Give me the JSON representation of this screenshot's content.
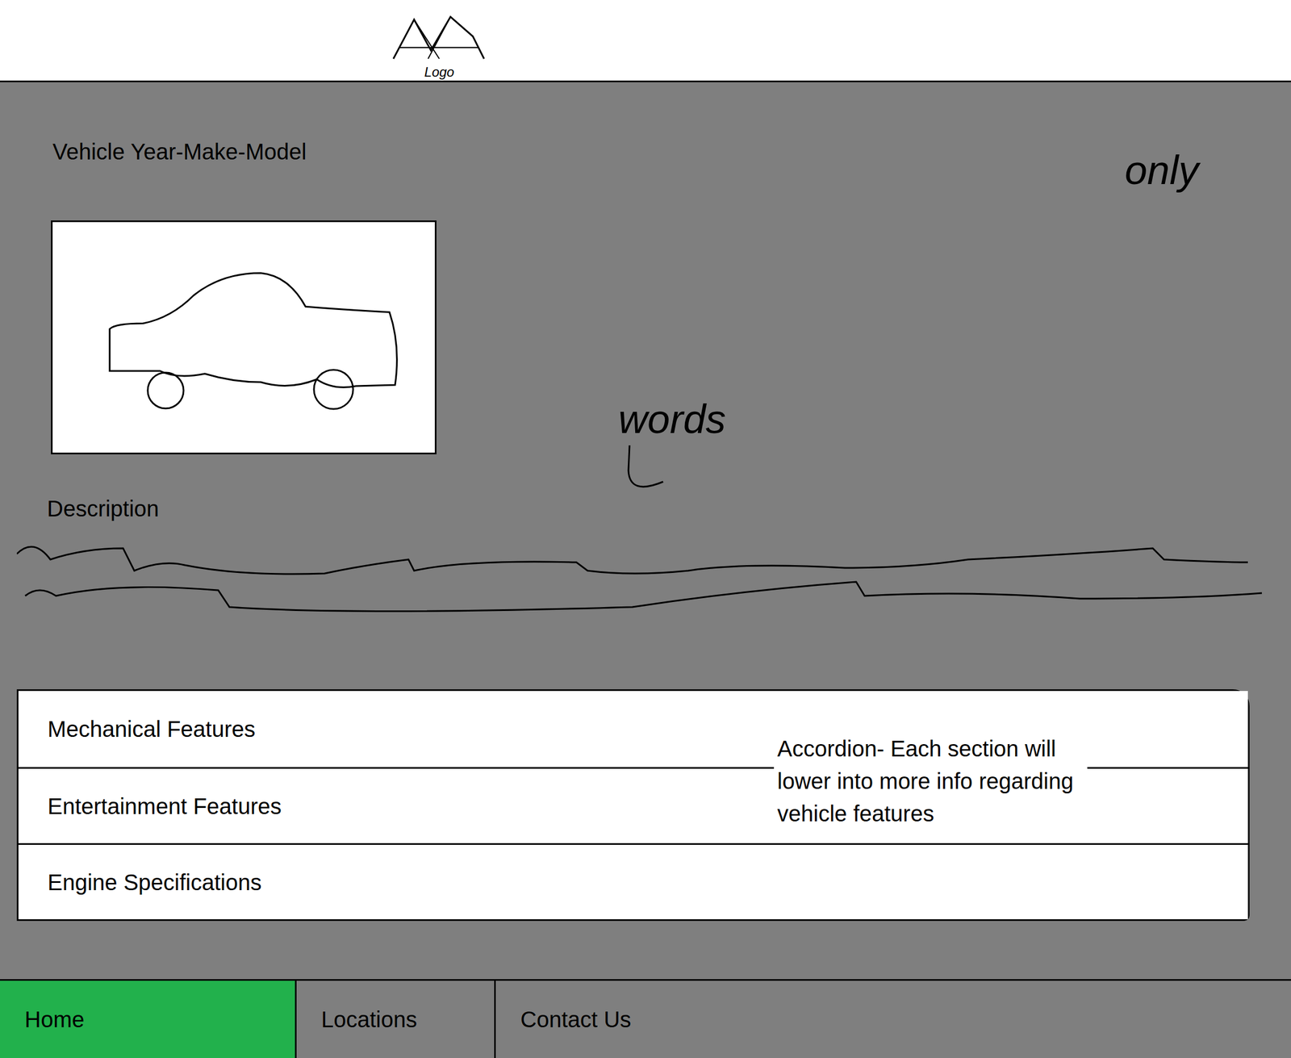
{
  "header": {
    "logo": "Logo"
  },
  "vehicle": {
    "title": "Vehicle Year-Make-Model",
    "description_label": "Description"
  },
  "notes": {
    "corner": "only",
    "middle": "words",
    "accordion": "Accordion- Each section will lower into more info regarding vehicle features"
  },
  "accordion": [
    {
      "label": "Mechanical Features",
      "expanded": false
    },
    {
      "label": "Entertainment Features",
      "expanded": false
    },
    {
      "label": "Engine Specifications",
      "expanded": false
    }
  ],
  "nav": [
    {
      "label": "Home",
      "selected": true
    },
    {
      "label": "Locations",
      "selected": false
    },
    {
      "label": "Contact Us",
      "selected": false
    }
  ]
}
